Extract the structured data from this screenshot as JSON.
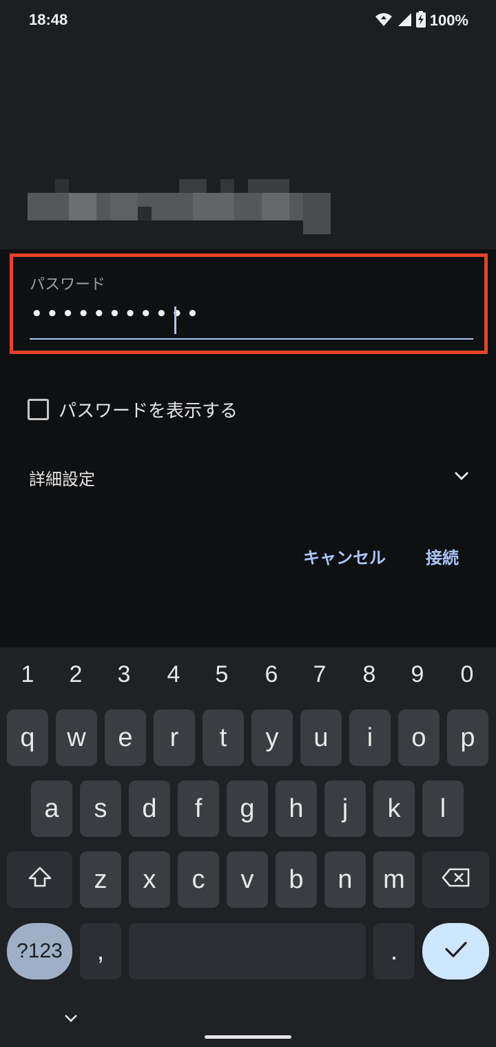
{
  "status_bar": {
    "time": "18:48",
    "battery": "100%",
    "icons": [
      "wifi-icon",
      "signal-icon",
      "battery-charging-icon"
    ]
  },
  "dialog": {
    "password_label": "パスワード",
    "password_masked": "•••••••••••",
    "show_password_label": "パスワードを表示する",
    "advanced_label": "詳細設定",
    "cancel_label": "キャンセル",
    "connect_label": "接続"
  },
  "keyboard": {
    "numbers": [
      "1",
      "2",
      "3",
      "4",
      "5",
      "6",
      "7",
      "8",
      "9",
      "0"
    ],
    "row1": [
      "q",
      "w",
      "e",
      "r",
      "t",
      "y",
      "u",
      "i",
      "o",
      "p"
    ],
    "row2": [
      "a",
      "s",
      "d",
      "f",
      "g",
      "h",
      "j",
      "k",
      "l"
    ],
    "row3": [
      "z",
      "x",
      "c",
      "v",
      "b",
      "n",
      "m"
    ],
    "symbols_label": "?123",
    "comma": ",",
    "period": "."
  },
  "colors": {
    "accent": "#a8c7fa",
    "highlight_border": "#e5432a"
  }
}
